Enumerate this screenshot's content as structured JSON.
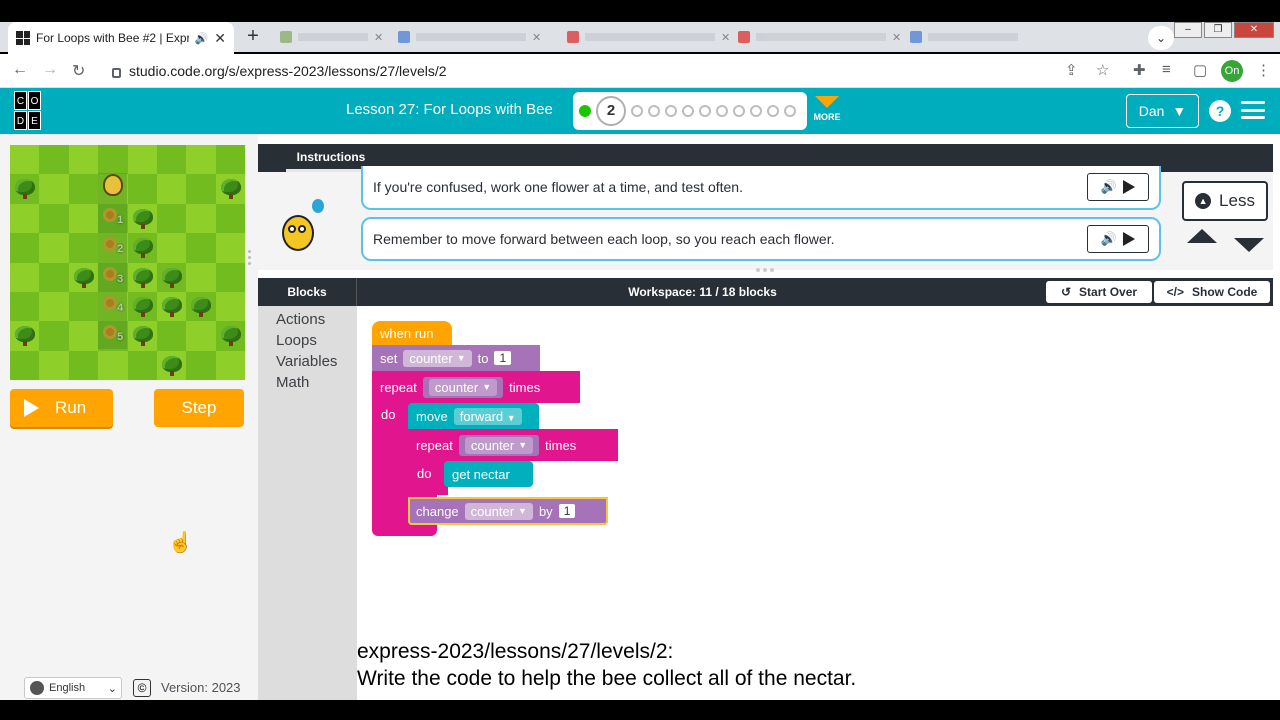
{
  "browser": {
    "active_tab_title": "For Loops with Bee #2 | Expr",
    "url": "studio.code.org/s/express-2023/lessons/27/levels/2",
    "profile_initials": "On"
  },
  "header": {
    "logo_letters": [
      "C",
      "O",
      "D",
      "E"
    ],
    "lesson_title": "Lesson 27: For Loops with Bee",
    "current_level": "2",
    "more_label": "MORE",
    "user_name": "Dan",
    "help_label": "?"
  },
  "game": {
    "flower_labels": [
      "1",
      "2",
      "3",
      "4",
      "5"
    ],
    "run_label": "Run",
    "step_label": "Step"
  },
  "instructions": {
    "tab_label": "Instructions",
    "lines": [
      "If you're confused, work one flower at a time, and test often.",
      "Remember to move forward between each loop, so you reach each flower."
    ],
    "less_label": "Less"
  },
  "workspace": {
    "blocks_label": "Blocks",
    "workspace_label": "Workspace: 11 / 18 blocks",
    "start_over_label": "Start Over",
    "show_code_label": "Show Code",
    "toolbox_categories": [
      "Actions",
      "Loops",
      "Variables",
      "Math"
    ],
    "code": {
      "when_run": "when run",
      "set": "set",
      "to": "to",
      "variable": "counter",
      "init_value": "1",
      "repeat": "repeat",
      "times": "times",
      "do": "do",
      "move": "move",
      "direction": "forward",
      "get_nectar": "get nectar",
      "change": "change",
      "by": "by",
      "change_value": "1"
    }
  },
  "footer": {
    "language": "English",
    "copyright_symbol": "©",
    "version": "Version: 2023"
  },
  "caption": {
    "line1": "express-2023/lessons/27/levels/2:",
    "line2": "Write the code to help the bee collect all of the nectar."
  },
  "colors": {
    "header_teal": "#00adbc",
    "orange": "#ffa400",
    "loop_magenta": "#e1168e",
    "variable_purple": "#a773b8",
    "action_cyan": "#00b0bd"
  }
}
